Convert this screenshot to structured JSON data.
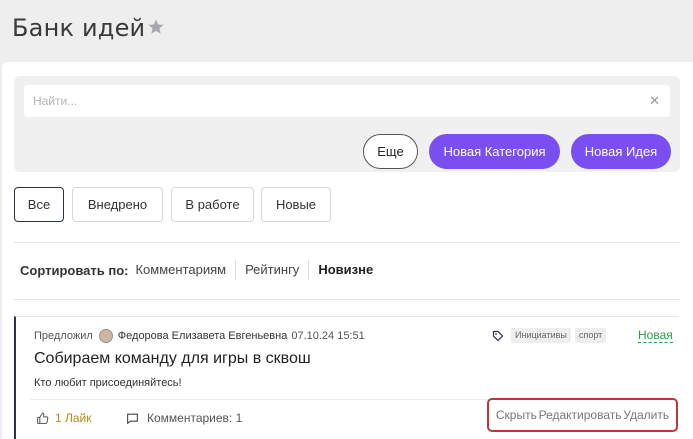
{
  "header": {
    "title": "Банк идей",
    "star_icon": "star-icon"
  },
  "search": {
    "placeholder": "Найти...",
    "value": ""
  },
  "toolbar": {
    "more_label": "Еще",
    "new_category_label": "Новая Категория",
    "new_idea_label": "Новая Идея",
    "accent_color": "#7b4ef2"
  },
  "filters": [
    {
      "label": "Все",
      "active": true
    },
    {
      "label": "Внедрено",
      "active": false
    },
    {
      "label": "В работе",
      "active": false
    },
    {
      "label": "Новые",
      "active": false
    }
  ],
  "sort": {
    "label": "Сортировать по:",
    "options": [
      "Комментариям",
      "Рейтингу",
      "Новизне"
    ],
    "selected": "Новизне"
  },
  "idea": {
    "proposed_label": "Предложил",
    "author": "Федорова Елизавета Евгеньевна",
    "date": "07.10.24 15:51",
    "tags": [
      "Инициативы",
      "спорт"
    ],
    "status": "Новая",
    "status_color": "#2e9d3a",
    "title": "Собираем команду для игры в сквош",
    "description": "Кто любит присоединяйтесь!",
    "likes": "1 Лайк",
    "comments": "Комментариев: 1",
    "actions": {
      "hide": "Скрыть",
      "edit": "Редактировать",
      "delete": "Удалить"
    }
  }
}
